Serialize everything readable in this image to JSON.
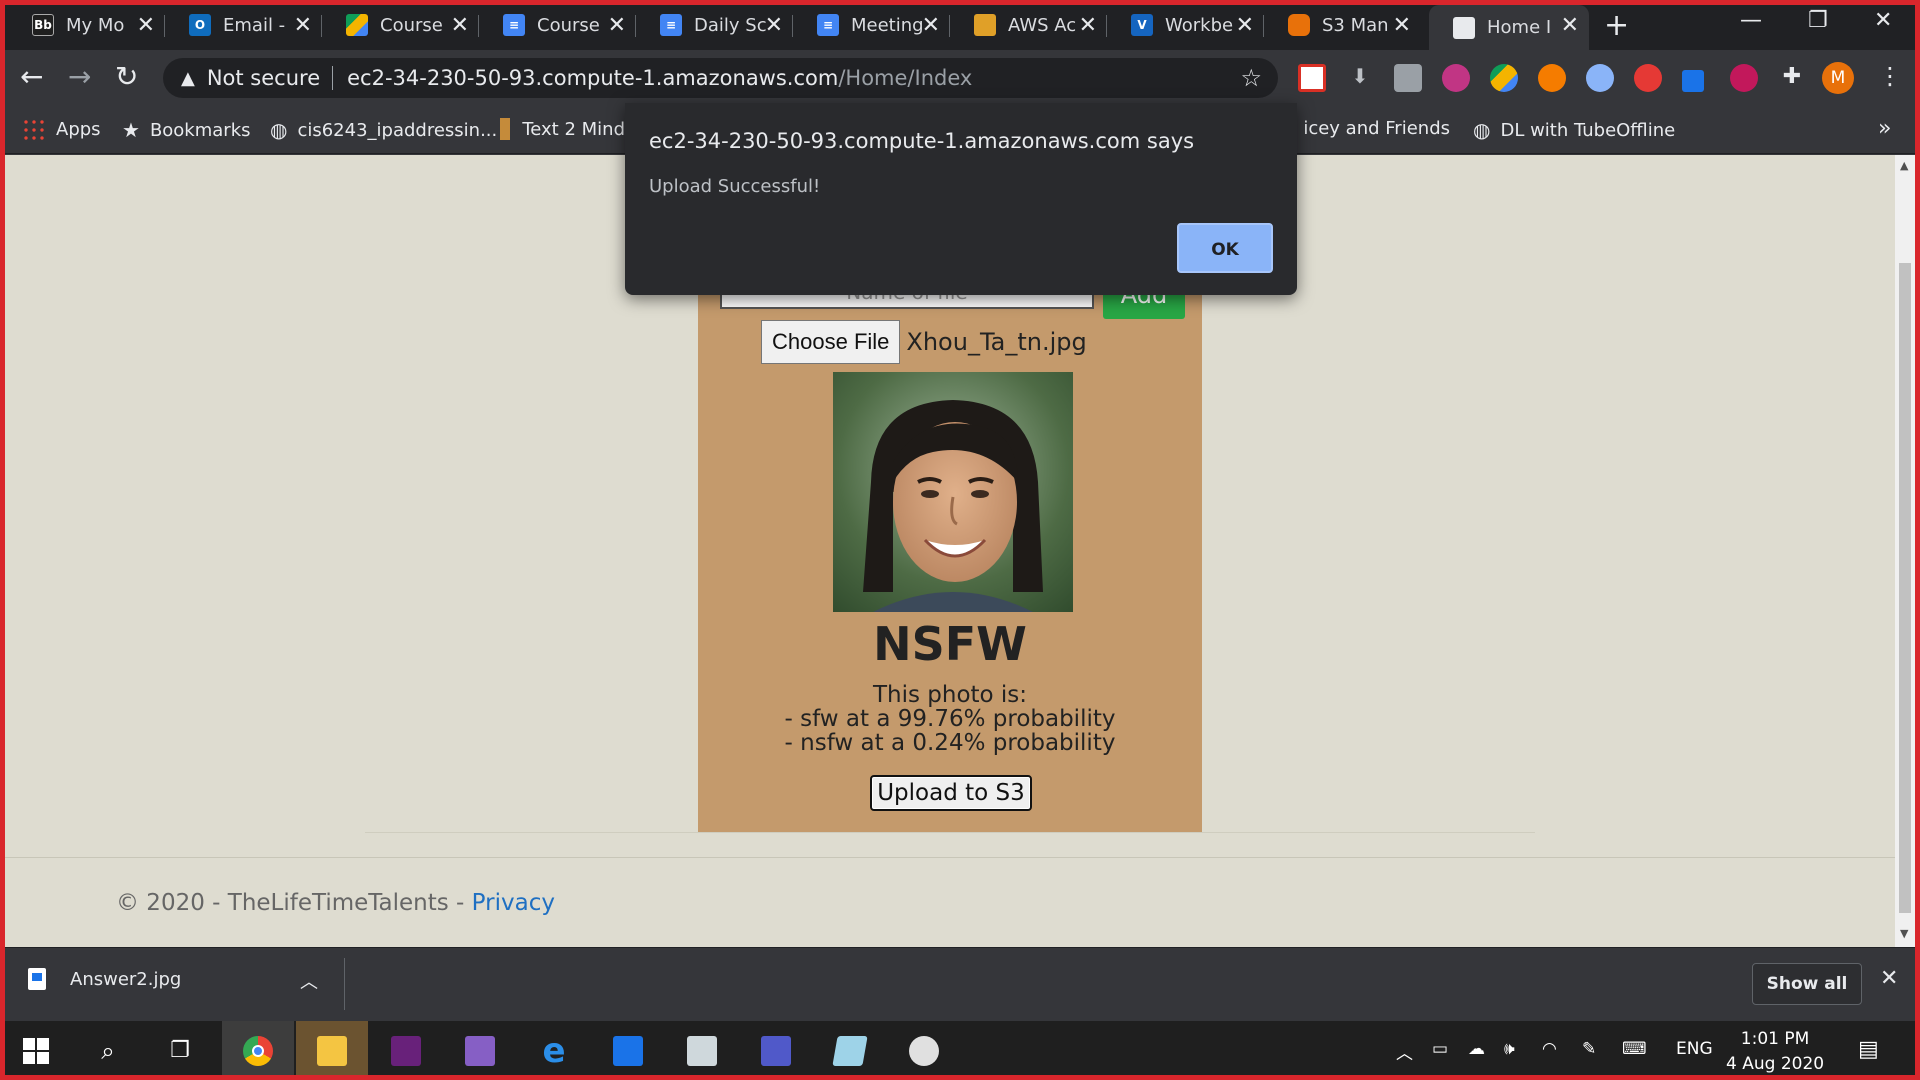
{
  "browser": {
    "tabs": [
      {
        "label": "My Mo",
        "icon": "blackboard-icon",
        "color": "#1f1f1f"
      },
      {
        "label": "Email -",
        "icon": "outlook-icon",
        "color": "#0f6cbd"
      },
      {
        "label": "Course",
        "icon": "google-drive-icon",
        "color": "#0f9d58"
      },
      {
        "label": "Course",
        "icon": "google-docs-icon",
        "color": "#4285f4"
      },
      {
        "label": "Daily Sc",
        "icon": "google-docs-icon",
        "color": "#4285f4"
      },
      {
        "label": "Meeting",
        "icon": "google-docs-icon",
        "color": "#4285f4"
      },
      {
        "label": "AWS Ac",
        "icon": "aws-box-icon",
        "color": "#e0a028"
      },
      {
        "label": "Workbe",
        "icon": "vocareum-icon",
        "color": "#1565c0"
      },
      {
        "label": "S3 Man",
        "icon": "aws-s3-icon",
        "color": "#e8710a"
      },
      {
        "label": "Home I",
        "icon": "page-icon",
        "color": "#e8eaed"
      }
    ],
    "address": {
      "security_label": "Not secure",
      "host": "ec2-34-230-50-93.compute-1.amazonaws.com",
      "path": "/Home/Index"
    },
    "profile_initial": "M",
    "bookmarks": [
      {
        "label": "Apps",
        "icon": "apps-grid-icon"
      },
      {
        "label": "Bookmarks",
        "icon": "star-icon"
      },
      {
        "label": "cis6243_ipaddressin...",
        "icon": "globe-icon"
      },
      {
        "label": "Text 2 Mind",
        "icon": "text2mind-icon"
      },
      {
        "label": "icey and Friends -...",
        "icon": "bookmark-icon"
      },
      {
        "label": "DL with TubeOffline",
        "icon": "globe-icon"
      }
    ]
  },
  "dialog": {
    "title": "ec2-34-230-50-93.compute-1.amazonaws.com says",
    "message": "Upload Successful!",
    "ok_label": "OK"
  },
  "page": {
    "name_placeholder": "Name of file",
    "add_label": "Add",
    "choose_file_label": "Choose File",
    "file_name": "Xhou_Ta_tn.jpg",
    "verdict": "NSFW",
    "result_line1": "This photo is:",
    "result_line2": "- sfw at a 99.76% probability",
    "result_line3": "- nsfw at a 0.24% probability",
    "upload_label": "Upload to S3",
    "footer_text": "© 2020 - TheLifeTimeTalents - ",
    "footer_link": "Privacy"
  },
  "downloads": {
    "file": "Answer2.jpg",
    "show_all_label": "Show all"
  },
  "taskbar": {
    "lang": "ENG",
    "time": "1:01 PM",
    "date": "4 Aug 2020"
  }
}
